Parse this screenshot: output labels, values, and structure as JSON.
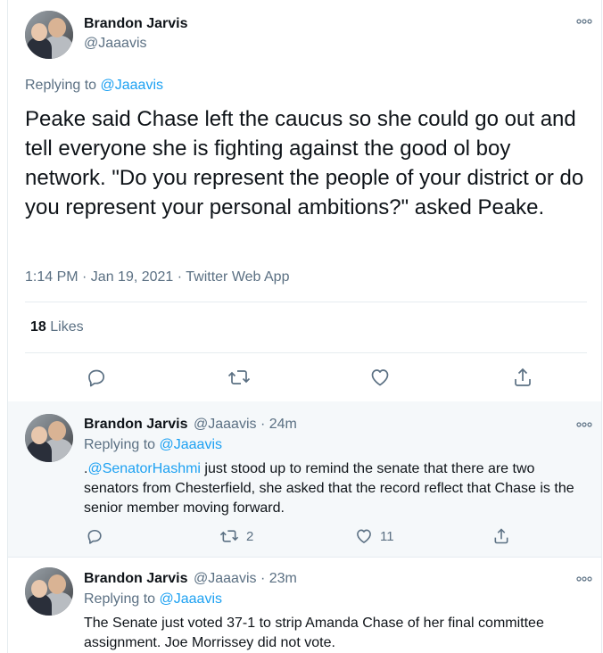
{
  "main_tweet": {
    "author_name": "Brandon Jarvis",
    "author_handle": "@Jaaavis",
    "replying_prefix": "Replying to ",
    "replying_to": "@Jaaavis",
    "text": "Peake said Chase left the caucus so she could go out and tell everyone she is fighting against the good ol boy network. \"Do you represent the people of your district or do you represent your personal ambitions?\" asked Peake.",
    "timestamp": "1:14 PM · Jan 19, 2021 · Twitter Web App",
    "likes_count": "18",
    "likes_label": "Likes"
  },
  "replies": [
    {
      "author_name": "Brandon Jarvis",
      "author_handle": "@Jaaavis · 24m",
      "replying_prefix": "Replying to ",
      "replying_to": "@Jaaavis",
      "text_prefix": ".",
      "mention": "@SenatorHashmi",
      "text": " just stood up to remind the senate that there are two senators from Chesterfield, she asked that the record reflect that Chase is the senior member moving forward.",
      "retweets": "2",
      "likes": "11"
    },
    {
      "author_name": "Brandon Jarvis",
      "author_handle": "@Jaaavis · 23m",
      "replying_prefix": "Replying to ",
      "replying_to": "@Jaaavis",
      "text": "The Senate just voted 37-1 to strip Amanda Chase of her final committee assignment. Joe Morrissey did not vote."
    }
  ],
  "icons": {
    "reply": "reply-icon",
    "retweet": "retweet-icon",
    "like": "heart-icon",
    "share": "share-icon",
    "more": "more-icon"
  },
  "colors": {
    "accent": "#1da1f2",
    "secondary_text": "#5b7083",
    "highlight_bg": "#f5f8fa"
  }
}
